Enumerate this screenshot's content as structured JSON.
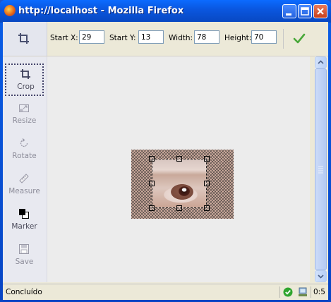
{
  "window": {
    "title": "http://localhost - Mozilla Firefox"
  },
  "toolbar": {
    "start_x_label": "Start X:",
    "start_x_value": "29",
    "start_y_label": "Start Y:",
    "start_y_value": "13",
    "width_label": "Width:",
    "width_value": "78",
    "height_label": "Height:",
    "height_value": "70",
    "current_tool_icon": "crop-icon",
    "apply_icon": "checkmark-icon"
  },
  "sidebar": {
    "items": [
      {
        "label": "Crop",
        "icon": "crop-icon",
        "active": true
      },
      {
        "label": "Resize",
        "icon": "resize-icon",
        "active": false
      },
      {
        "label": "Rotate",
        "icon": "rotate-icon",
        "active": false
      },
      {
        "label": "Measure",
        "icon": "ruler-icon",
        "active": false
      },
      {
        "label": "Marker",
        "icon": "color-swatch-icon",
        "active": false
      },
      {
        "label": "Save",
        "icon": "floppy-disk-icon",
        "active": false
      }
    ]
  },
  "statusbar": {
    "text": "Concluído",
    "count": "0:5"
  },
  "colors": {
    "titlebar": "#0a57e0",
    "accent_check": "#3aa33a"
  }
}
